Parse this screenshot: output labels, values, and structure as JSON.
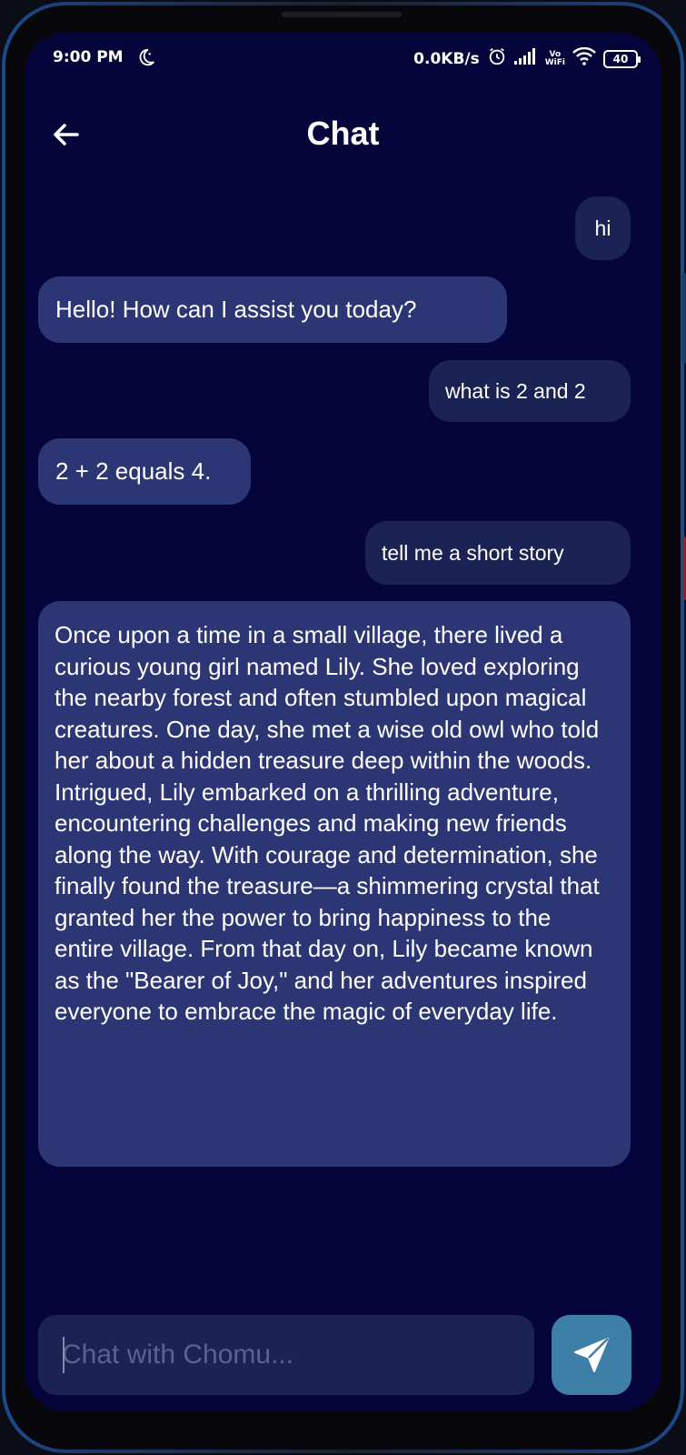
{
  "status_bar": {
    "time": "9:00 PM",
    "network_speed": "0.0KB/s",
    "vowifi_top": "Vo",
    "vowifi_bottom": "WiFi",
    "battery": "40"
  },
  "header": {
    "title": "Chat"
  },
  "messages": [
    {
      "role": "user",
      "text": "hi"
    },
    {
      "role": "bot",
      "text": "Hello! How can I assist you today?"
    },
    {
      "role": "user",
      "text": "what is 2 and 2"
    },
    {
      "role": "bot",
      "text": "2 + 2 equals 4."
    },
    {
      "role": "user",
      "text": "tell me a short story"
    },
    {
      "role": "bot",
      "text": "Once upon a time in a small village, there lived a curious young girl named Lily. She loved exploring the nearby forest and often stumbled upon magical creatures. One day, she met a wise old owl who told her about a hidden treasure deep within the woods. Intrigued, Lily embarked on a thrilling adventure, encountering challenges and making new friends along the way. With courage and determination, she finally found the treasure—a shimmering crystal that granted her the power to bring happiness to the entire village. From that day on, Lily became known as the \"Bearer of Joy,\" and her adventures inspired everyone to embrace the magic of everyday life."
    }
  ],
  "input": {
    "placeholder": "Chat with Chomu...",
    "value": ""
  },
  "colors": {
    "background": "#05053b",
    "user_bubble": "#1b2254",
    "bot_bubble": "#2d3674",
    "send_button": "#3d7fa6"
  },
  "icons": {
    "back": "arrow-left-icon",
    "send": "send-icon"
  }
}
